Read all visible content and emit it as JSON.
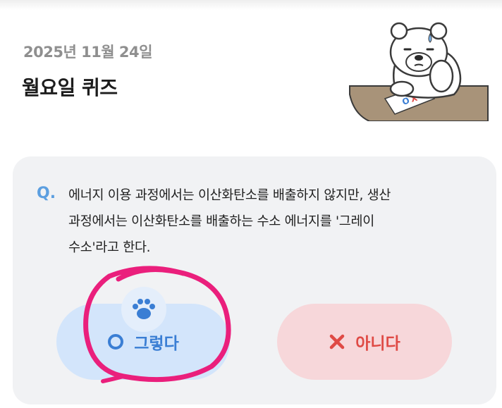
{
  "header": {
    "date": "2025년 11월 24일",
    "title": "월요일 퀴즈"
  },
  "mascot": {
    "icon": "polar-bear-icon",
    "paper_mark": "OX"
  },
  "quiz": {
    "q_label": "Q.",
    "question_lines": [
      "에너지 이용 과정에서는 이산화탄소를 배출하지 않지만, 생산",
      "과정에서는 이산화탄소를 배출하는 수소 에너지를 '그레이",
      "수소'라고 한다."
    ]
  },
  "answers": {
    "yes": {
      "label": "그렇다",
      "icon": "circle-o-icon",
      "selected": true
    },
    "no": {
      "label": "아니다",
      "icon": "x-mark-icon"
    }
  },
  "badge": {
    "icon": "paw-icon"
  },
  "colors": {
    "accent_blue": "#3a7ed4",
    "accent_red": "#df4a45",
    "annotation_pink": "#ea1f7c"
  }
}
